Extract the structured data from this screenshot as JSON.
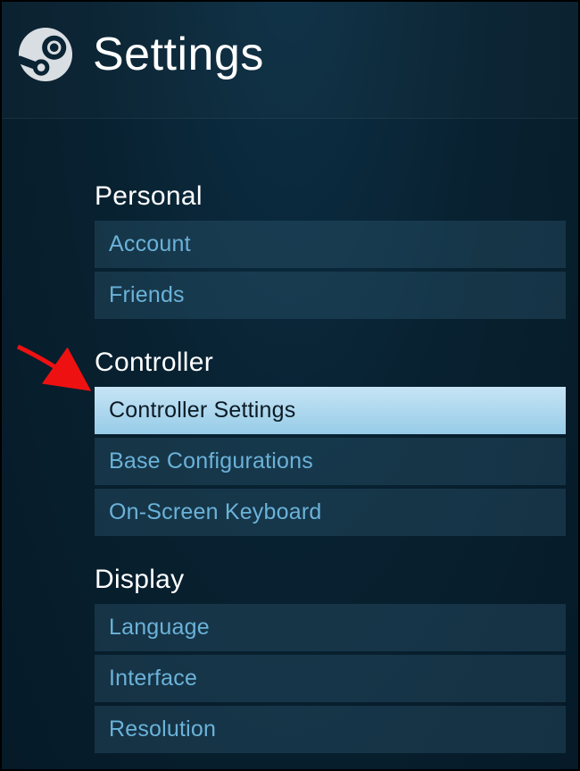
{
  "header": {
    "title": "Settings"
  },
  "sections": [
    {
      "title": "Personal",
      "items": [
        {
          "label": "Account",
          "selected": false
        },
        {
          "label": "Friends",
          "selected": false
        }
      ]
    },
    {
      "title": "Controller",
      "items": [
        {
          "label": "Controller Settings",
          "selected": true
        },
        {
          "label": "Base Configurations",
          "selected": false
        },
        {
          "label": "On-Screen Keyboard",
          "selected": false
        }
      ]
    },
    {
      "title": "Display",
      "items": [
        {
          "label": "Language",
          "selected": false
        },
        {
          "label": "Interface",
          "selected": false
        },
        {
          "label": "Resolution",
          "selected": false
        }
      ]
    }
  ],
  "annotation": {
    "arrow_points_to": "Controller Settings"
  }
}
